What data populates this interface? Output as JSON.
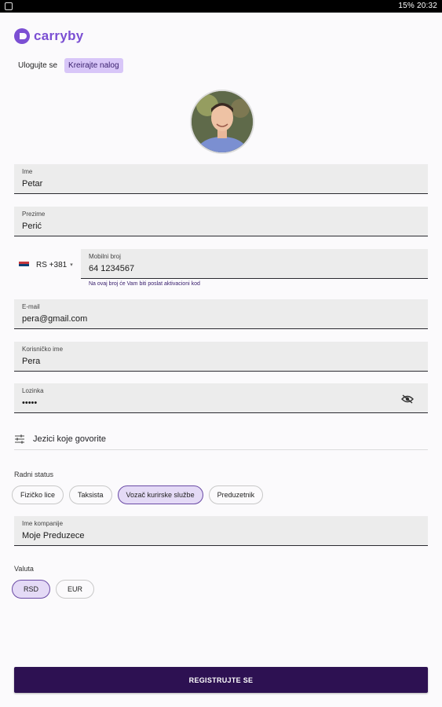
{
  "statusbar": {
    "indicators": "15% 20:32"
  },
  "brand": {
    "name": "carryby",
    "color": "#7b4fd3"
  },
  "auth_tabs": {
    "login": "Ulogujte se",
    "register": "Kreirajte nalog"
  },
  "form": {
    "first_name": {
      "label": "Ime",
      "value": "Petar"
    },
    "last_name": {
      "label": "Prezime",
      "value": "Perić"
    },
    "phone": {
      "country_code": "RS +381",
      "label": "Mobilni broj",
      "value": "64 1234567",
      "helper": "Na ovaj broj će Vam biti poslat aktivacioni kod"
    },
    "email": {
      "label": "E-mail",
      "value": "pera@gmail.com"
    },
    "username": {
      "label": "Korisničko ime",
      "value": "Pera"
    },
    "password": {
      "label": "Lozinka",
      "value": "•••••"
    },
    "languages_label": "Jezici koje govorite",
    "work_status": {
      "title": "Radni status",
      "options": [
        "Fizičko lice",
        "Taksista",
        "Vozač kurirske službe",
        "Preduzetnik"
      ],
      "selected": "Vozač kurirske službe"
    },
    "company": {
      "label": "Ime kompanije",
      "value": "Moje Preduzece"
    },
    "currency": {
      "title": "Valuta",
      "options": [
        "RSD",
        "EUR"
      ],
      "selected": "RSD"
    },
    "submit": "REGISTRUJTE SE"
  },
  "colors": {
    "primary_dark": "#2d1152",
    "accent": "#7b4fd3",
    "chip_selected_bg": "#e4daf6"
  }
}
